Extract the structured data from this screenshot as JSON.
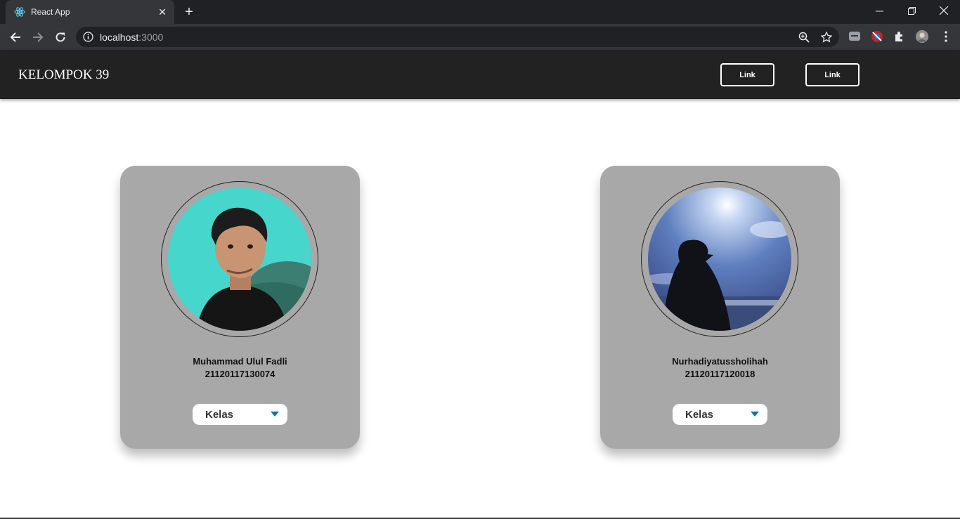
{
  "browser": {
    "tab_title": "React App",
    "url_host": "localhost",
    "url_port": ":3000"
  },
  "navbar": {
    "brand": "KELOMPOK 39",
    "links": [
      "Link",
      "Link"
    ]
  },
  "cards": [
    {
      "name": "Muhammad Ulul Fadli",
      "nim": "21120117130074",
      "dropdown_label": "Kelas"
    },
    {
      "name": "Nurhadiyatussholihah",
      "nim": "21120117120018",
      "dropdown_label": "Kelas"
    }
  ],
  "colors": {
    "navbar_bg": "#222222",
    "card_bg": "#a8a8a8",
    "caret": "#0b72a8"
  }
}
